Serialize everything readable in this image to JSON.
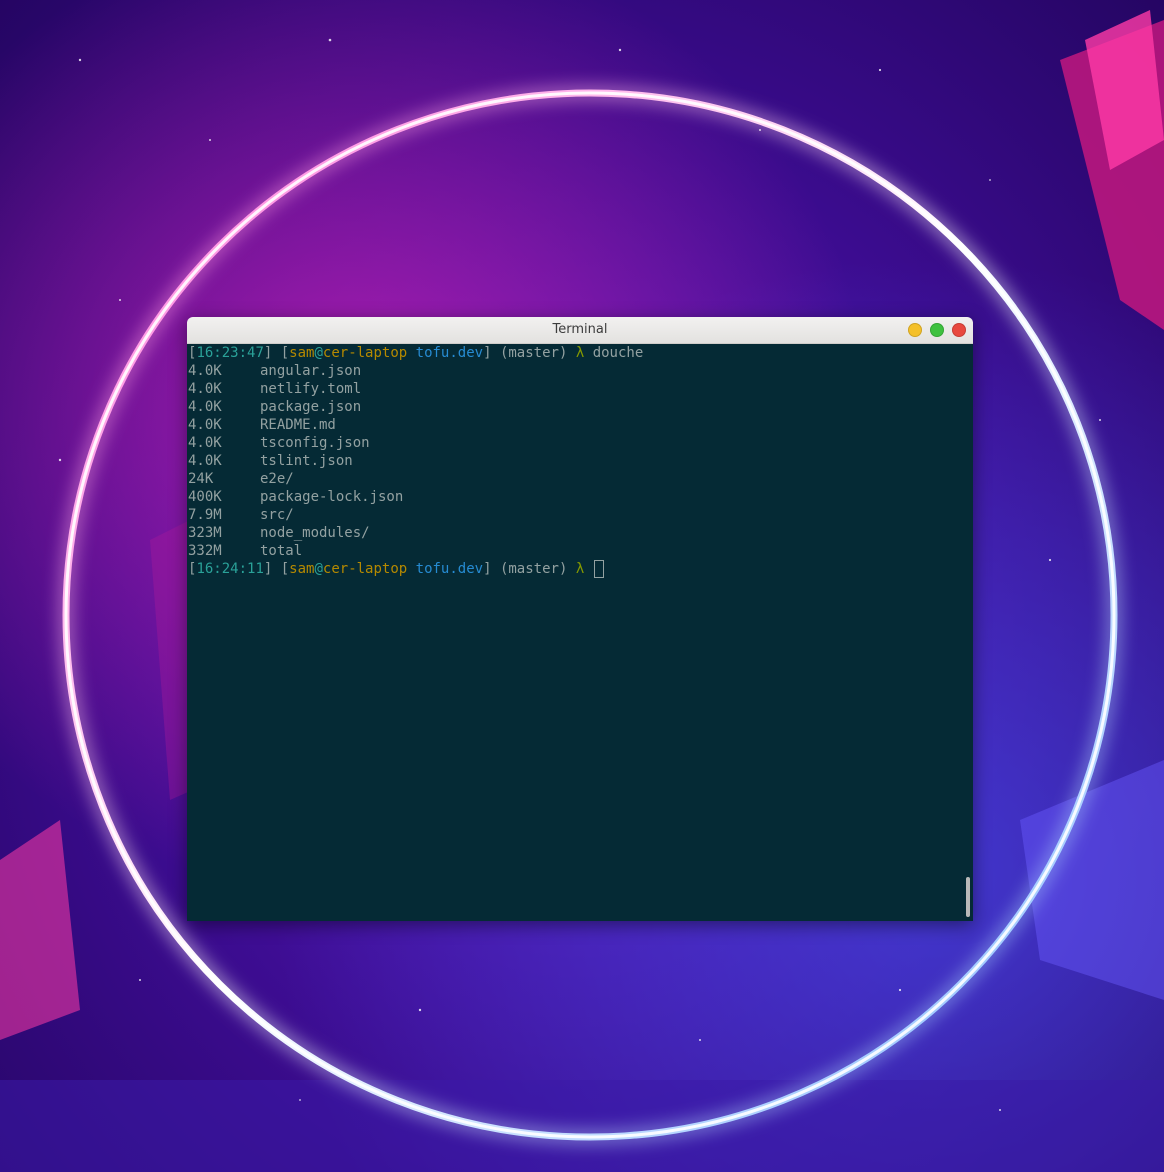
{
  "window": {
    "title": "Terminal"
  },
  "terminal": {
    "prompts": [
      {
        "time": "16:23:47",
        "user": "sam",
        "at": "@",
        "host": "cer-laptop",
        "dir": "tofu.dev",
        "branch": "(master)",
        "symbol": "λ",
        "command": "douche"
      },
      {
        "time": "16:24:11",
        "user": "sam",
        "at": "@",
        "host": "cer-laptop",
        "dir": "tofu.dev",
        "branch": "(master)",
        "symbol": "λ",
        "command": ""
      }
    ],
    "listing": [
      {
        "size": "4.0K",
        "name": "angular.json"
      },
      {
        "size": "4.0K",
        "name": "netlify.toml"
      },
      {
        "size": "4.0K",
        "name": "package.json"
      },
      {
        "size": "4.0K",
        "name": "README.md"
      },
      {
        "size": "4.0K",
        "name": "tsconfig.json"
      },
      {
        "size": "4.0K",
        "name": "tslint.json"
      },
      {
        "size": "24K",
        "name": "e2e/"
      },
      {
        "size": "400K",
        "name": "package-lock.json"
      },
      {
        "size": "7.9M",
        "name": "src/"
      },
      {
        "size": "323M",
        "name": "node_modules/"
      },
      {
        "size": "332M",
        "name": "total"
      }
    ]
  },
  "colors": {
    "terminal_bg": "#052a35",
    "text": "#93a1a1",
    "time": "#2aa198",
    "user_host": "#b58900",
    "dir": "#268bd2",
    "lambda": "#859900"
  }
}
